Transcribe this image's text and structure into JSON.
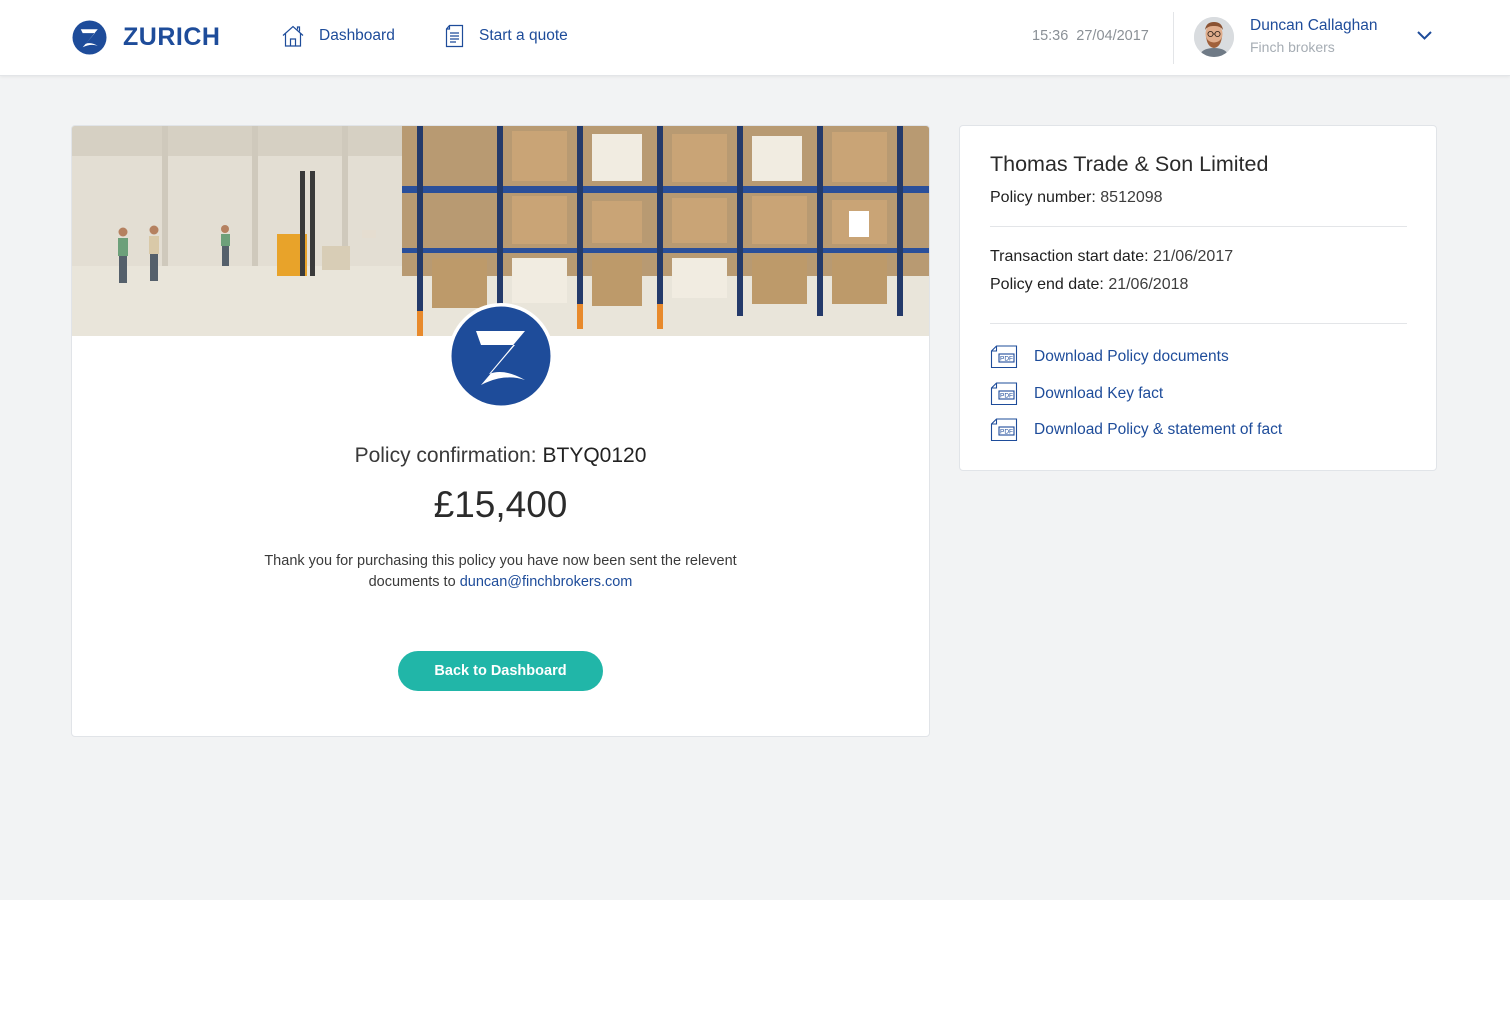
{
  "brand": {
    "name": "ZURICH",
    "primary": "#1e4c9a",
    "accent": "#21b6a8"
  },
  "nav": {
    "dashboard": {
      "label": "Dashboard",
      "icon": "home-icon"
    },
    "quote": {
      "label": "Start a quote",
      "icon": "document-icon"
    }
  },
  "header": {
    "time": "15:36",
    "date": "27/04/2017",
    "user": {
      "name": "Duncan Callaghan",
      "company": "Finch brokers"
    }
  },
  "confirmation": {
    "label": "Policy confirmation:",
    "code": "BTYQ0120",
    "price": "£15,400",
    "message": "Thank you for purchasing this policy you have now been sent the relevent documents to",
    "email": "duncan@finchbrokers.com",
    "back_button": "Back to Dashboard"
  },
  "policy": {
    "company": "Thomas Trade & Son Limited",
    "number_label": "Policy number:",
    "number": "8512098",
    "start_label": "Transaction start date:",
    "start": "21/06/2017",
    "end_label": "Policy end date:",
    "end": "21/06/2018",
    "pdf_icon_text": "PDF",
    "downloads": [
      {
        "label": "Download Policy documents",
        "icon": "pdf-icon"
      },
      {
        "label": "Download Key fact",
        "icon": "pdf-icon"
      },
      {
        "label": "Download Policy & statement of fact",
        "icon": "pdf-icon"
      }
    ]
  }
}
